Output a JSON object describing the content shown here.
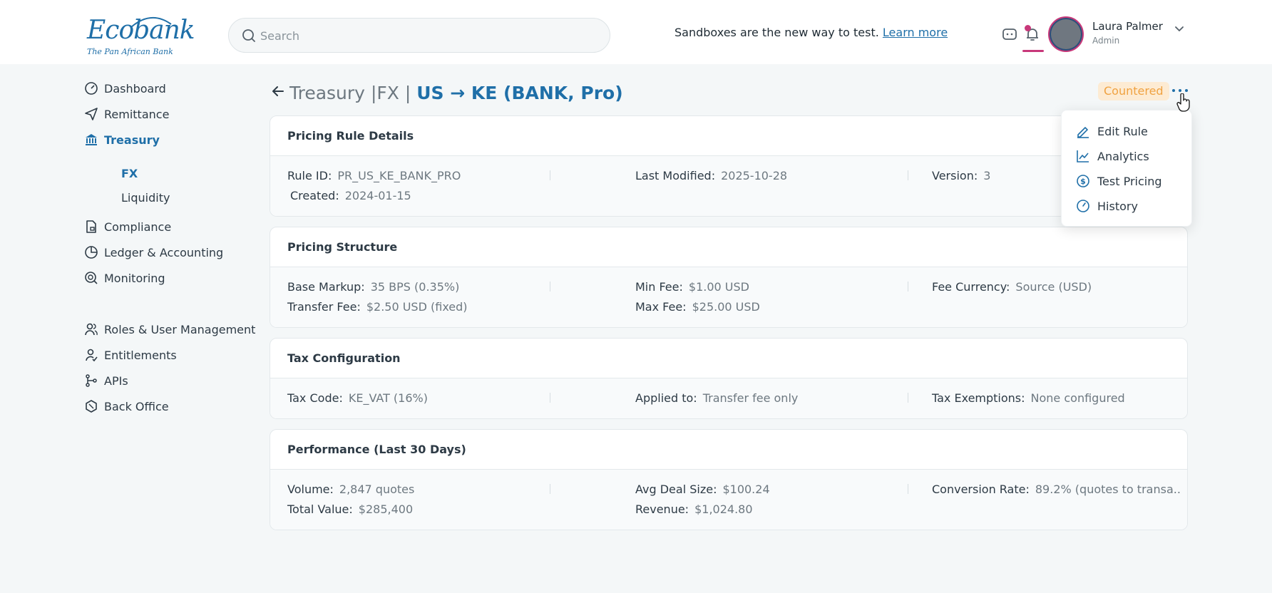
{
  "brand": {
    "name": "Ecobank",
    "tagline": "The Pan African Bank",
    "accent": "#1f6fa8",
    "highlight": "#c8387a"
  },
  "search": {
    "placeholder": "Search",
    "value": ""
  },
  "promo": {
    "text": "Sandboxes are the new way to test. ",
    "link": "Learn more"
  },
  "user": {
    "name": "Laura Palmer",
    "role": "Admin"
  },
  "sidebar": {
    "items": [
      {
        "label": "Dashboard",
        "icon": "gauge-icon"
      },
      {
        "label": "Remittance",
        "icon": "send-icon"
      },
      {
        "label": "Treasury",
        "icon": "bank-icon",
        "active": true
      },
      {
        "label": "Compliance",
        "icon": "document-lock-icon"
      },
      {
        "label": "Ledger & Accounting",
        "icon": "pie-chart-icon"
      },
      {
        "label": "Monitoring",
        "icon": "monitor-search-icon"
      },
      {
        "label": "Roles & User Management",
        "icon": "users-icon"
      },
      {
        "label": "Entitlements",
        "icon": "user-check-icon"
      },
      {
        "label": "APIs",
        "icon": "git-branch-icon"
      },
      {
        "label": "Back Office",
        "icon": "hexagon-icon"
      }
    ],
    "treasury_sub": [
      {
        "label": "FX",
        "active": true
      },
      {
        "label": "Liquidity"
      }
    ]
  },
  "page": {
    "crumb1": "Treasury",
    "divider": "|",
    "crumb2": "FX",
    "title": "US → KE (BANK, Pro)",
    "status": "Countered",
    "status_color": "#f0a241"
  },
  "cards": {
    "details": {
      "title": "Pricing Rule Details",
      "rule_id_label": "Rule ID:",
      "rule_id": "PR_US_KE_BANK_PRO",
      "created_label": "Created:",
      "created": "2024-01-15",
      "modified_label": "Last Modified:",
      "modified": "2025-10-28",
      "version_label": "Version:",
      "version": "3"
    },
    "structure": {
      "title": "Pricing Structure",
      "markup_label": "Base Markup:",
      "markup": "35 BPS (0.35%)",
      "transfer_label": "Transfer Fee:",
      "transfer": "$2.50 USD (fixed)",
      "min_label": "Min Fee:",
      "min": "$1.00 USD",
      "max_label": "Max Fee:",
      "max": "$25.00 USD",
      "currency_label": "Fee Currency:",
      "currency": "Source (USD)"
    },
    "tax": {
      "title": "Tax Configuration",
      "code_label": "Tax Code:",
      "code": "KE_VAT (16%)",
      "applied_label": "Applied to:",
      "applied": "Transfer fee only",
      "exempt_label": "Tax Exemptions:",
      "exempt": "None configured"
    },
    "performance": {
      "title": "Performance (Last 30 Days)",
      "volume_label": "Volume:",
      "volume": "2,847 quotes",
      "total_label": "Total Value:",
      "total": "$285,400",
      "avg_label": "Avg Deal Size:",
      "avg": "$100.24",
      "revenue_label": "Revenue:",
      "revenue": "$1,024.80",
      "conversion_label": "Conversion Rate:",
      "conversion": "89.2% (quotes to transa..."
    }
  },
  "menu": {
    "items": [
      {
        "label": "Edit Rule",
        "icon": "pencil-icon"
      },
      {
        "label": "Analytics",
        "icon": "line-chart-icon"
      },
      {
        "label": "Test Pricing",
        "icon": "dollar-circle-icon"
      },
      {
        "label": "History",
        "icon": "clock-icon"
      }
    ]
  }
}
